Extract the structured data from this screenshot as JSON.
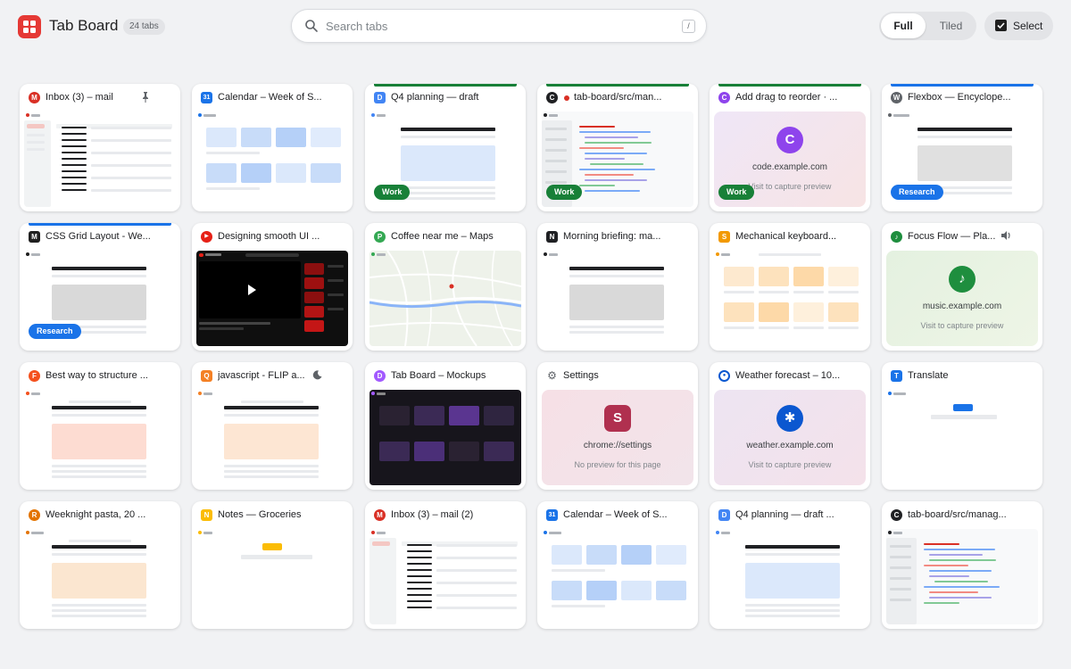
{
  "app": {
    "title": "Tab Board",
    "tab_count": "24 tabs"
  },
  "search": {
    "placeholder": "Search tabs",
    "shortcut": "/"
  },
  "view": {
    "full_label": "Full",
    "tiled_label": "Tiled",
    "active": "Full"
  },
  "select": {
    "label": "Select"
  },
  "colors": {
    "accent": "#e53935",
    "work": "#188038",
    "research": "#1a73e8",
    "pinned_bg": "#ffffff"
  },
  "tabs": [
    {
      "title": "Inbox (3) – mail",
      "favicon_letter": "M",
      "favicon_color": "#d93025",
      "icon": "pin-icon"
    },
    {
      "title": "Calendar – Week of S...",
      "favicon_letter": "31",
      "favicon_color": "#1a73e8"
    },
    {
      "title": "Q4 planning — draft",
      "favicon_letter": "D",
      "favicon_color": "#4285f4",
      "group": "Work"
    },
    {
      "title": "tab-board/src/man...",
      "favicon_letter": "C",
      "favicon_color": "#202124",
      "group": "Work",
      "recording": true
    },
    {
      "title": "Add drag to reorder · ...",
      "favicon_letter": "C",
      "favicon_color": "#8e44ec",
      "group": "Work",
      "fallback": {
        "avatar": "C",
        "domain": "code.example.com",
        "sub": "Visit to capture preview"
      }
    },
    {
      "title": "Flexbox — Encyclope...",
      "favicon_letter": "W",
      "favicon_color": "#5f6368",
      "group": "Research"
    },
    {
      "title": "CSS Grid Layout - We...",
      "favicon_letter": "M",
      "favicon_color": "#1f1f1f",
      "group": "Research"
    },
    {
      "title": "Designing smooth UI ...",
      "favicon_letter": "▶",
      "favicon_color": "#e62117"
    },
    {
      "title": "Coffee near me – Maps",
      "favicon_letter": "P",
      "favicon_color": "#34a853"
    },
    {
      "title": "Morning briefing: ma...",
      "favicon_letter": "N",
      "favicon_color": "#202124"
    },
    {
      "title": "Mechanical keyboard...",
      "favicon_letter": "S",
      "favicon_color": "#f29900"
    },
    {
      "title": "Focus Flow — Pla...",
      "favicon_letter": "♪",
      "favicon_color": "#1e8e3e",
      "icon": "speaker-icon",
      "fallback": {
        "avatar": "♪",
        "domain": "music.example.com",
        "sub": "Visit to capture preview"
      }
    },
    {
      "title": "Best way to structure ...",
      "favicon_letter": "F",
      "favicon_color": "#f4511e"
    },
    {
      "title": "javascript - FLIP a...",
      "favicon_letter": "Q",
      "favicon_color": "#f48024",
      "icon": "moon-icon"
    },
    {
      "title": "Tab Board – Mockups",
      "favicon_letter": "D",
      "favicon_color": "#a259ff"
    },
    {
      "title": "Settings",
      "favicon_letter": "⚙",
      "favicon_color": "#5f6368",
      "fallback": {
        "avatar": "S",
        "domain": "chrome://settings",
        "sub": "No preview for this page"
      }
    },
    {
      "title": "Weather forecast – 10...",
      "favicon_letter": "●",
      "favicon_color": "#0b57d0",
      "fallback": {
        "avatar": "✱",
        "domain": "weather.example.com",
        "sub": "Visit to capture preview"
      }
    },
    {
      "title": "Translate",
      "favicon_letter": "T",
      "favicon_color": "#1a73e8"
    },
    {
      "title": "Weeknight pasta, 20 ...",
      "favicon_letter": "R",
      "favicon_color": "#e37400"
    },
    {
      "title": "Notes — Groceries",
      "favicon_letter": "N",
      "favicon_color": "#fbbc04"
    },
    {
      "title": "Inbox (3) – mail (2)",
      "favicon_letter": "M",
      "favicon_color": "#d93025"
    },
    {
      "title": "Calendar – Week of S...",
      "favicon_letter": "31",
      "favicon_color": "#1a73e8"
    },
    {
      "title": "Q4 planning — draft ...",
      "favicon_letter": "D",
      "favicon_color": "#4285f4"
    },
    {
      "title": "tab-board/src/manag...",
      "favicon_letter": "C",
      "favicon_color": "#202124"
    }
  ]
}
